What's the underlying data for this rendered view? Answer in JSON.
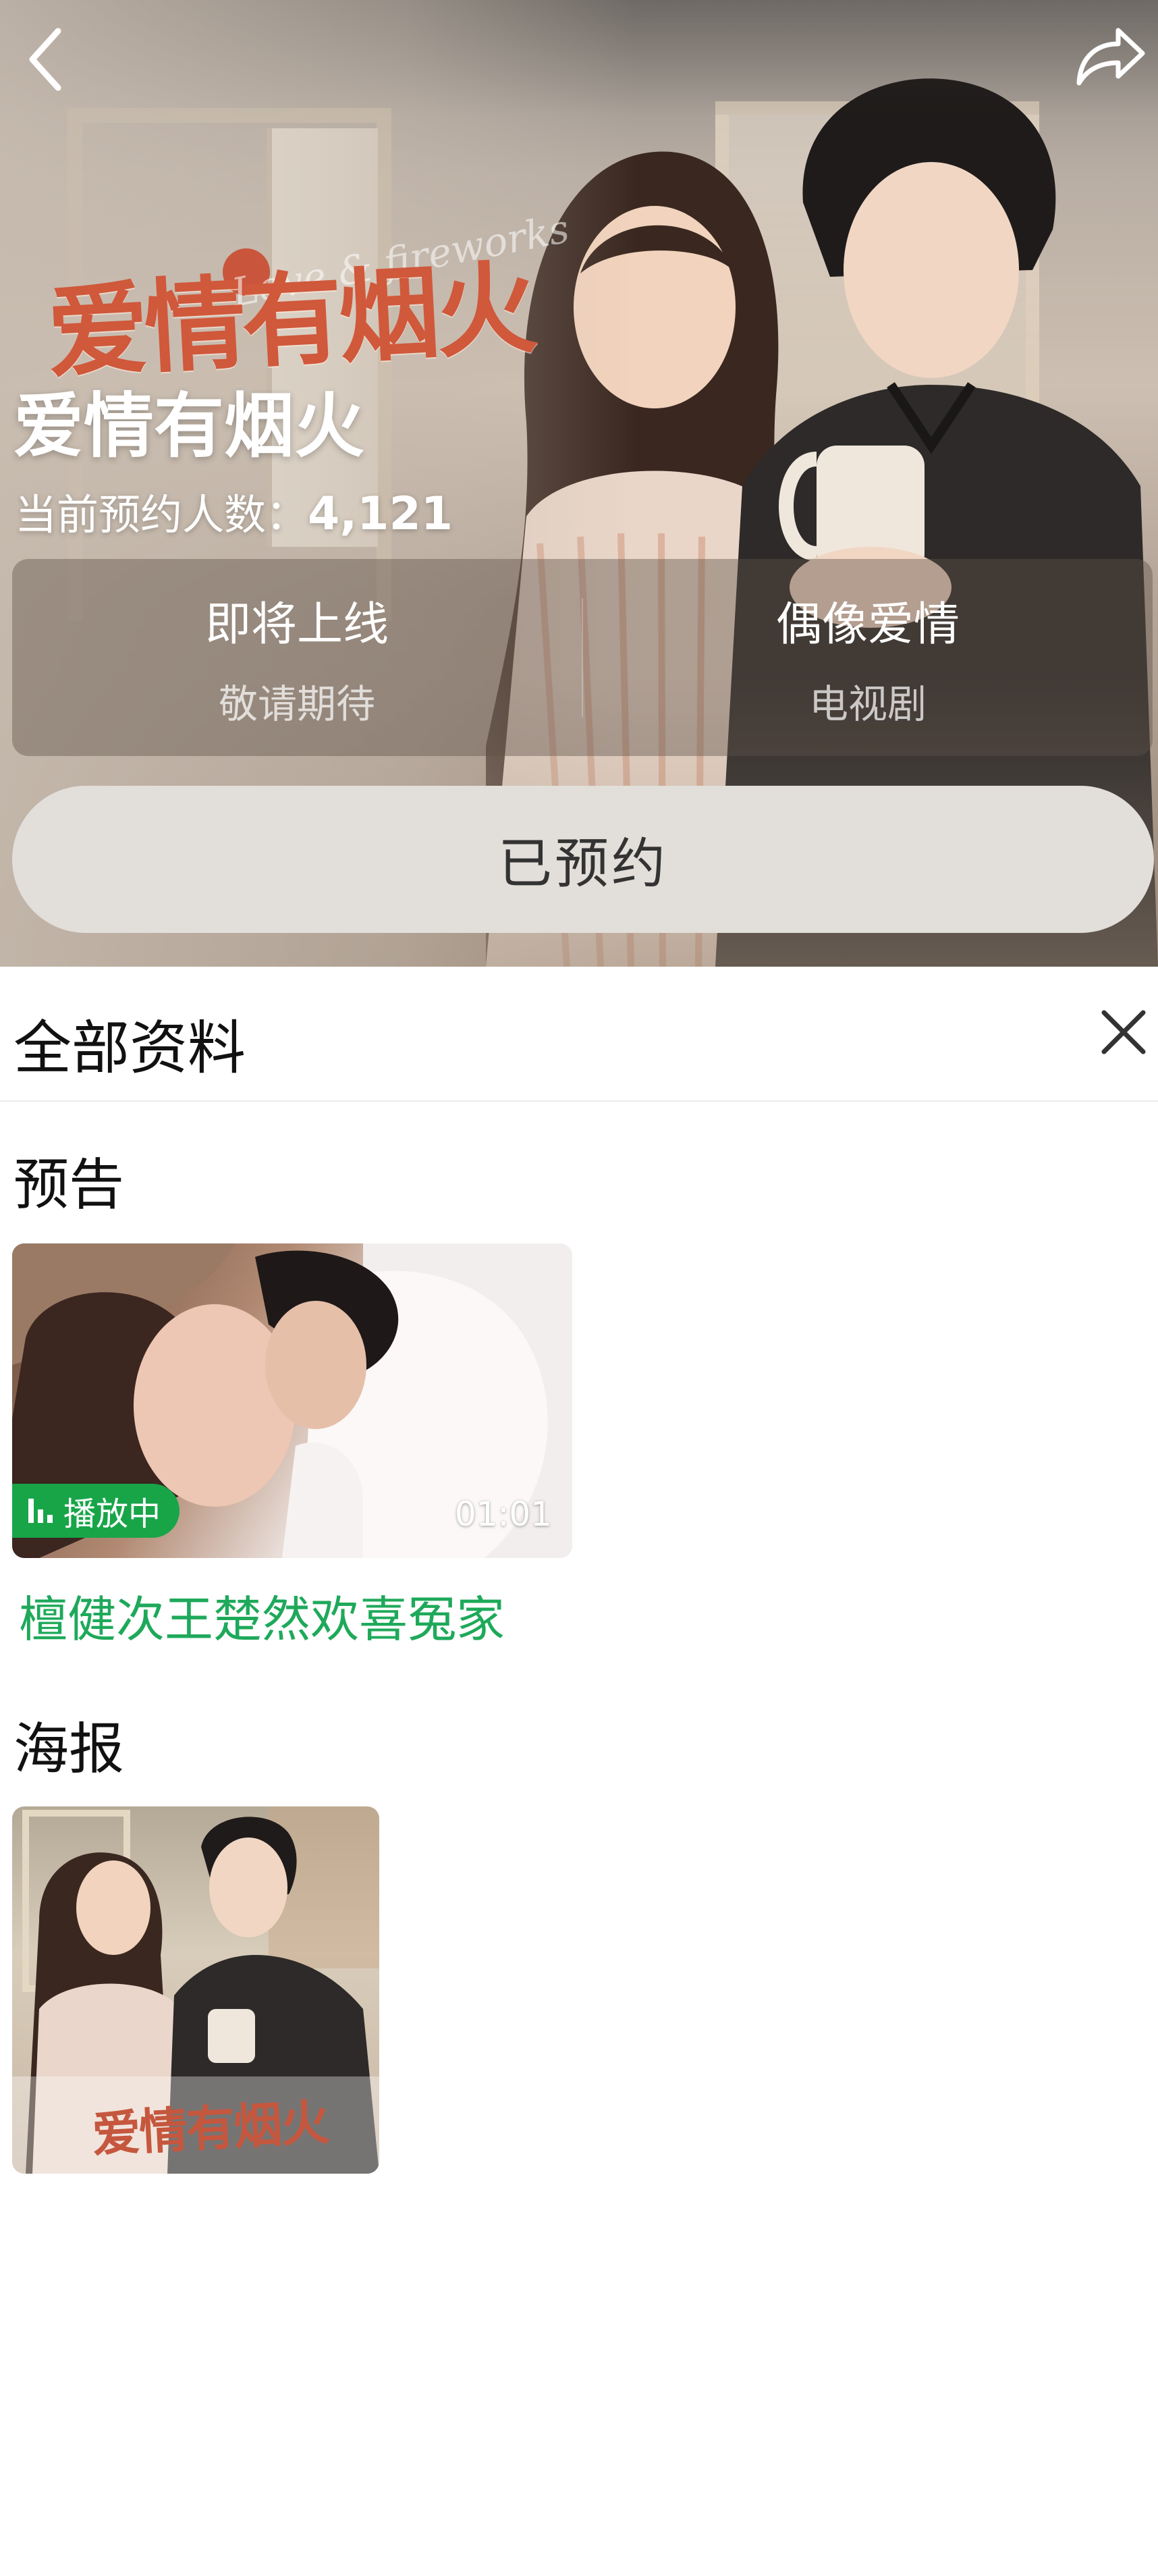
{
  "header": {
    "back_icon": "chevron-left-icon",
    "share_icon": "share-forward-icon"
  },
  "hero": {
    "logo_text": "爱情有烟火",
    "logo_script": "Love & fireworks",
    "title": "爱情有烟火",
    "reservation_label": "当前预约人数：",
    "reservation_count": "4,121",
    "info": [
      {
        "main": "即将上线",
        "sub": "敬请期待"
      },
      {
        "main": "偶像爱情",
        "sub": "电视剧"
      }
    ],
    "reserve_button": "已预约"
  },
  "sheet": {
    "title": "全部资料",
    "close_icon": "close-icon",
    "trailer_section": "预告",
    "trailer": {
      "status": "播放中",
      "duration": "01:01",
      "caption": "檀健次王楚然欢喜冤家"
    },
    "poster_section": "海报",
    "poster": {
      "logo_text": "爱情有烟火"
    }
  },
  "colors": {
    "accent_green": "#17a548",
    "caption_green": "#1ea95a",
    "logo_red": "#d0583b",
    "button_bg": "#e2ded9"
  }
}
